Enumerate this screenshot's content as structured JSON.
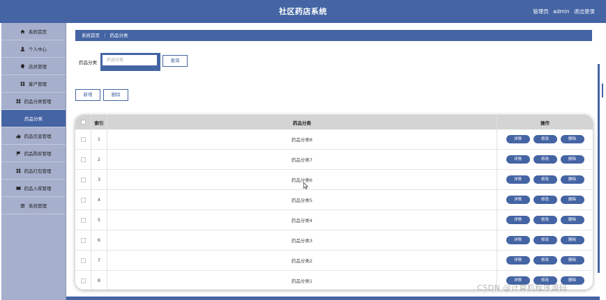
{
  "header": {
    "title": "社区药店系统",
    "role": "管理员",
    "username": "admin",
    "logout_label": "退出登录"
  },
  "sidebar": {
    "items": [
      {
        "label": "系统首页",
        "icon": "home-icon"
      },
      {
        "label": "个人中心",
        "icon": "user-icon"
      },
      {
        "label": "店员管理",
        "icon": "pin-icon"
      },
      {
        "label": "客户管理",
        "icon": "grid-icon"
      },
      {
        "label": "药品分类管理",
        "icon": "grid-icon"
      },
      {
        "label": "药品分类",
        "icon": "",
        "active": true
      },
      {
        "label": "药品信息管理",
        "icon": "thumb-icon"
      },
      {
        "label": "药品购买管理",
        "icon": "flag-icon"
      },
      {
        "label": "药品打包管理",
        "icon": "grid-icon"
      },
      {
        "label": "药品入库管理",
        "icon": "ticket-icon"
      },
      {
        "label": "系统管理",
        "icon": "list-icon"
      }
    ]
  },
  "breadcrumb": {
    "home": "系统首页",
    "separator": "⋮",
    "current": "药品分类"
  },
  "search": {
    "label": "药品分类",
    "placeholder": "药品分类",
    "value": "",
    "query_label": "查询"
  },
  "toolbar": {
    "add_label": "新增",
    "delete_label": "删除"
  },
  "table": {
    "headers": {
      "index": "索引",
      "name": "药品分类",
      "ops": "操作"
    },
    "actions": {
      "detail": "详情",
      "edit": "修改",
      "delete": "删除"
    },
    "rows": [
      {
        "index": "1",
        "name": "药品分类8"
      },
      {
        "index": "2",
        "name": "药品分类7"
      },
      {
        "index": "3",
        "name": "药品分类6"
      },
      {
        "index": "4",
        "name": "药品分类5"
      },
      {
        "index": "5",
        "name": "药品分类4"
      },
      {
        "index": "6",
        "name": "药品分类3"
      },
      {
        "index": "7",
        "name": "药品分类2"
      },
      {
        "index": "8",
        "name": "药品分类1"
      }
    ]
  },
  "watermark": "CSDN @计算机程序源码",
  "colors": {
    "primary": "#4464a4",
    "sidebar": "#a6afcc",
    "table_header": "#d4d4d4"
  }
}
